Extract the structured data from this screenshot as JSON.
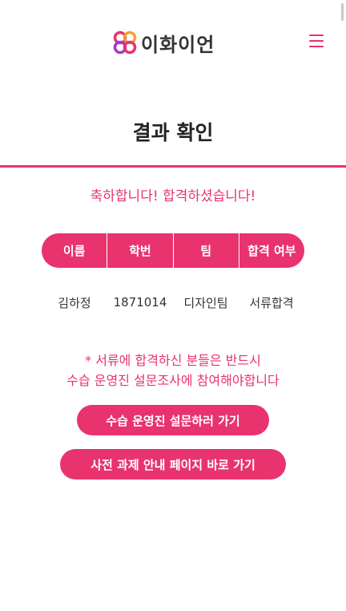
{
  "header": {
    "logo_text": "이화이언",
    "logo_icon": "ewhaian-flower-logo-icon",
    "menu_icon": "hamburger-menu-icon"
  },
  "page": {
    "title": "결과 확인",
    "congrats": "축하합니다! 합격하셨습니다!"
  },
  "result_table": {
    "headers": [
      "이름",
      "학번",
      "팀",
      "합격 여부"
    ],
    "row": [
      "김하정",
      "1871014",
      "디자인팀",
      "서류합격"
    ]
  },
  "notice": {
    "line1": "* 서류에 합격하신 분들은 반드시",
    "line2": "수습 운영진 설문조사에 참여해야합니다"
  },
  "buttons": {
    "survey": "수습 운영진 설문하러 가기",
    "assignment": "사전 과제 안내 페이지 바로 가기"
  },
  "colors": {
    "accent": "#e8336e",
    "text": "#222222",
    "background": "#ffffff"
  }
}
